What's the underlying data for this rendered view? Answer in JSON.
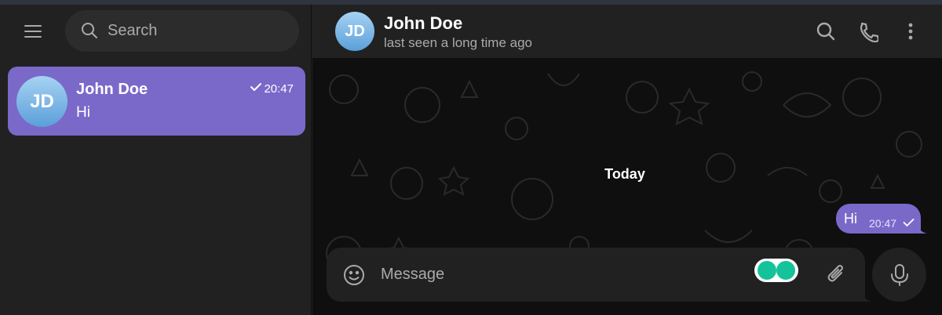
{
  "sidebar": {
    "search_placeholder": "Search",
    "chats": [
      {
        "name": "John Doe",
        "initials": "JD",
        "preview": "Hi",
        "time": "20:47"
      }
    ]
  },
  "header": {
    "initials": "JD",
    "name": "John Doe",
    "status": "last seen a long time ago"
  },
  "conversation": {
    "date_label": "Today",
    "messages": [
      {
        "text": "Hi",
        "time": "20:47",
        "outgoing": true
      }
    ]
  },
  "composer": {
    "placeholder": "Message"
  },
  "colors": {
    "accent": "#7a69c9",
    "panel": "#212121",
    "background": "#0f0f0f",
    "muted_text": "#aaaaaa"
  },
  "icons": [
    "menu-icon",
    "search-icon",
    "check-icon",
    "phone-icon",
    "more-vertical-icon",
    "emoji-icon",
    "attach-icon",
    "mic-icon"
  ]
}
